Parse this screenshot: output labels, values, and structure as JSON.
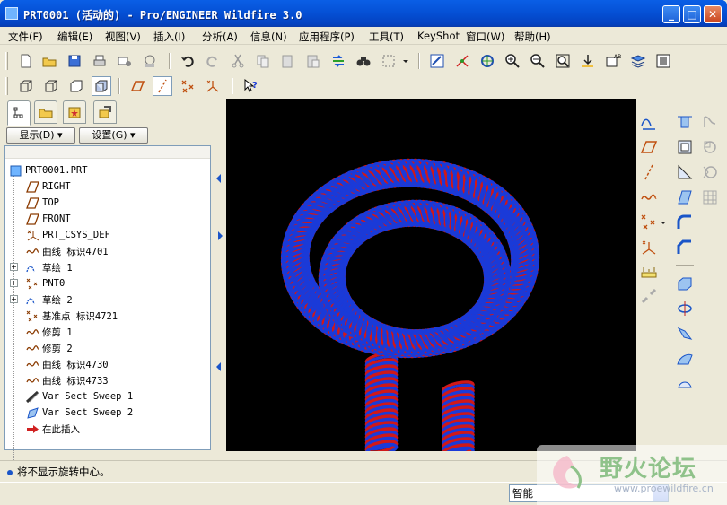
{
  "window": {
    "title": "PRT0001 (活动的) - Pro/ENGINEER Wildfire 3.0"
  },
  "menu": [
    "文件(F)",
    "编辑(E)",
    "视图(V)",
    "插入(I)",
    "分析(A)",
    "信息(N)",
    "应用程序(P)",
    "工具(T)",
    "KeyShot",
    "窗口(W)",
    "帮助(H)"
  ],
  "panel": {
    "show_label": "显示(D) ▾",
    "settings_label": "设置(G) ▾"
  },
  "tree": [
    {
      "label": "PRT0001.PRT",
      "icon": "part-icon"
    },
    {
      "label": "RIGHT",
      "icon": "datum-plane-icon"
    },
    {
      "label": "TOP",
      "icon": "datum-plane-icon"
    },
    {
      "label": "FRONT",
      "icon": "datum-plane-icon"
    },
    {
      "label": "PRT_CSYS_DEF",
      "icon": "csys-icon"
    },
    {
      "label": "曲线 标识4701",
      "icon": "curve-icon"
    },
    {
      "label": "草绘 1",
      "icon": "sketch-icon"
    },
    {
      "label": "PNT0",
      "icon": "datum-point-icon"
    },
    {
      "label": "草绘 2",
      "icon": "sketch-icon"
    },
    {
      "label": "基准点 标识4721",
      "icon": "datum-point-icon"
    },
    {
      "label": "修剪 1",
      "icon": "curve-icon"
    },
    {
      "label": "修剪 2",
      "icon": "curve-icon"
    },
    {
      "label": "曲线 标识4730",
      "icon": "curve-icon"
    },
    {
      "label": "曲线 标识4733",
      "icon": "curve-icon"
    },
    {
      "label": "Var Sect Sweep 1",
      "icon": "sweep-icon"
    },
    {
      "label": "Var Sect Sweep 2",
      "icon": "sweep-icon"
    },
    {
      "label": "在此插入",
      "icon": "insert-here-arrow-icon"
    }
  ],
  "status": {
    "message": "将不显示旋转中心。"
  },
  "filter": {
    "value": "智能"
  },
  "watermark": {
    "text": "野火论坛",
    "url": "www.proewildfire.cn"
  },
  "colors": {
    "spring_red": "#d01818",
    "spring_blue": "#1a3ad8",
    "viewport_bg": "#000000"
  }
}
